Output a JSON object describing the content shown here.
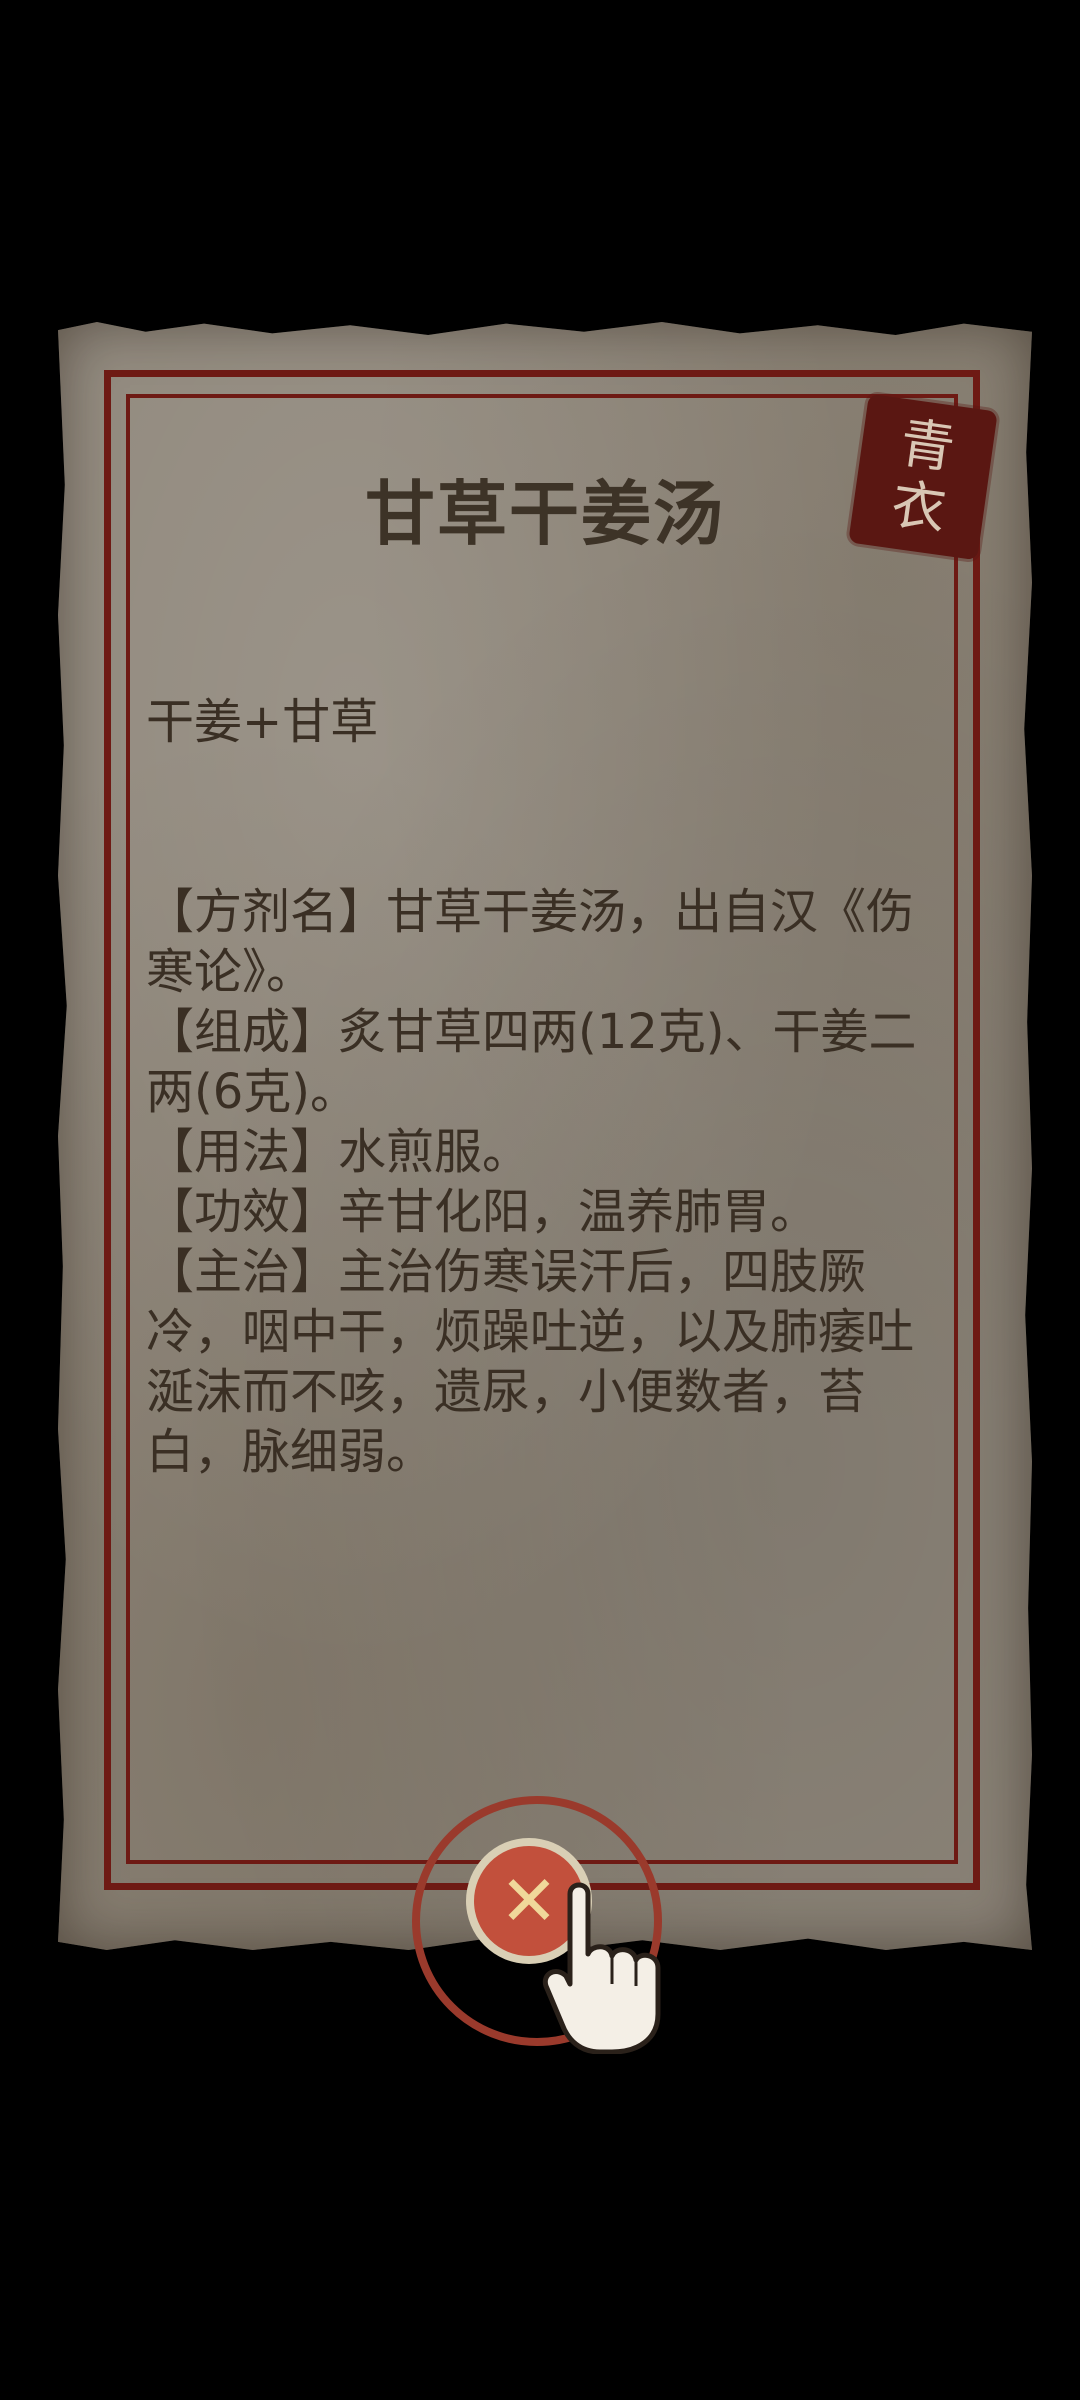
{
  "card": {
    "title": "甘草干姜汤",
    "seal_text_top": "青",
    "seal_text_bottom": "衣",
    "formula": "干姜+甘草",
    "details": [
      "【方剂名】甘草干姜汤，出自汉《伤寒论》。",
      "【组成】炙甘草四两(12克)、干姜二两(6克)。",
      "【用法】水煎服。",
      "【功效】辛甘化阳，温养肺胃。",
      "【主治】主治伤寒误汗后，四肢厥冷，咽中干，烦躁吐逆，以及肺痿吐涎沫而不咳，遗尿，小便数者，苔白，脉细弱。"
    ]
  },
  "close_button": {
    "icon": "close-icon",
    "glyph": "✕"
  },
  "colors": {
    "paper": "#8f877b",
    "border": "#6e1a14",
    "seal": "#5a1712",
    "close": "#c2503c"
  }
}
